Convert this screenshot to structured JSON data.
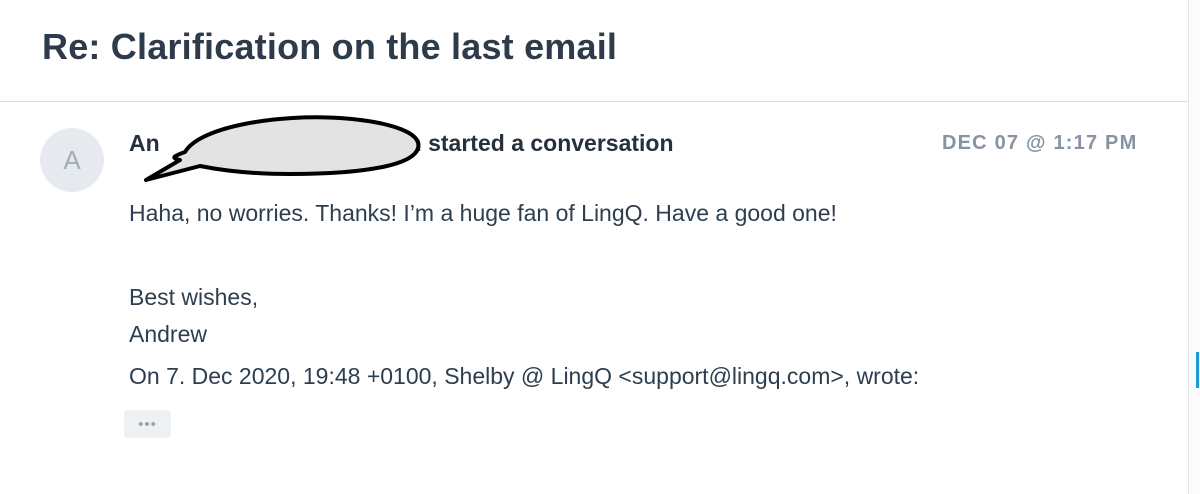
{
  "conversation": {
    "title": "Re: Clarification on the last email"
  },
  "message": {
    "avatar_initial": "A",
    "author_visible_start": "An",
    "author_visible_end": "n started a conversation",
    "timestamp": "DEC 07 @ 1:17 PM",
    "body_lines": [
      "Haha, no worries. Thanks! I’m a huge fan of LingQ. Have a good one!",
      "Best wishes,",
      "Andrew",
      "On 7. Dec 2020, 19:48 +0100, Shelby @ LingQ <support@lingq.com>, wrote:"
    ],
    "quoted_toggle": "•••"
  },
  "icons": {
    "redaction": "speech-bubble-redaction-icon"
  },
  "colors": {
    "title": "#2e3b4a",
    "body_text": "#2d3e4f",
    "timestamp": "#8793a3",
    "avatar_bg": "#e6eaef",
    "redaction_fill": "#e3e3e3",
    "scroll_accent": "#1e9bd7"
  }
}
